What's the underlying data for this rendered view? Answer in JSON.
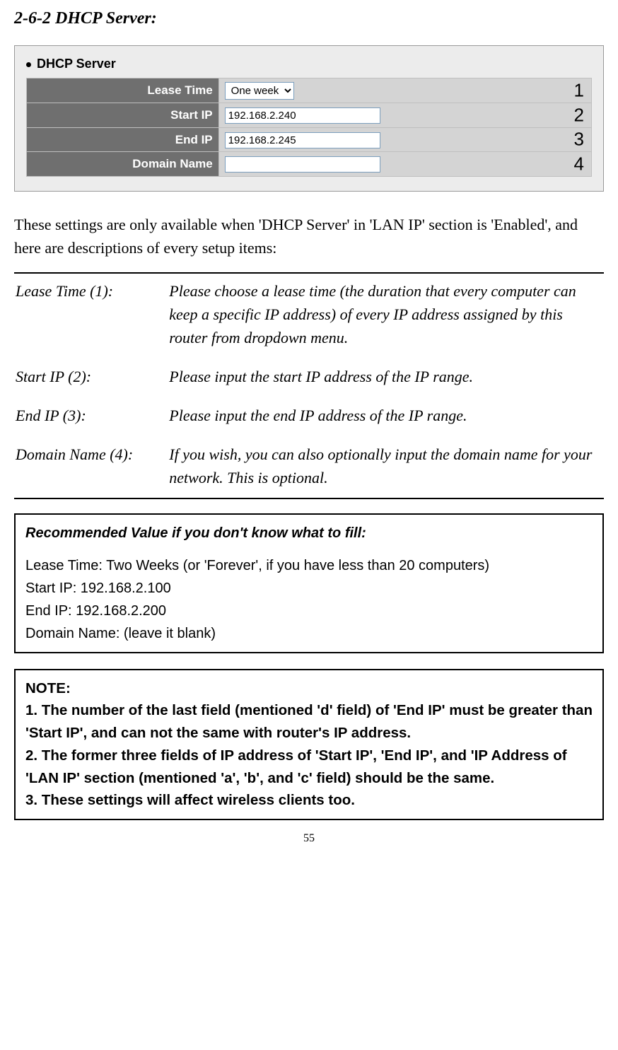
{
  "section_title": "2-6-2 DHCP Server:",
  "panel": {
    "title": "DHCP Server",
    "rows": [
      {
        "label": "Lease Time",
        "type": "select",
        "value": "One week",
        "num": "1"
      },
      {
        "label": "Start IP",
        "type": "text",
        "value": "192.168.2.240",
        "num": "2"
      },
      {
        "label": "End IP",
        "type": "text",
        "value": "192.168.2.245",
        "num": "3"
      },
      {
        "label": "Domain Name",
        "type": "text",
        "value": "",
        "num": "4"
      }
    ]
  },
  "intro": "These settings are only available when 'DHCP Server' in 'LAN IP' section is 'Enabled', and here are descriptions of every setup items:",
  "descriptions": [
    {
      "term": "Lease Time (1):",
      "desc": "Please choose a lease time (the duration that every computer can keep a specific IP address) of every IP address assigned by this router from dropdown menu."
    },
    {
      "term": "Start IP (2):",
      "desc": "Please input the start IP address of the IP range."
    },
    {
      "term": "End IP (3):",
      "desc": "Please input the end IP address of the IP range."
    },
    {
      "term": "Domain Name (4):",
      "desc": "If you wish, you can also optionally input the domain name for your network. This is optional."
    }
  ],
  "recommend": {
    "title": "Recommended Value if you don't know what to fill:",
    "lines": [
      "Lease Time: Two Weeks (or 'Forever', if you have less than 20 computers)",
      "Start IP: 192.168.2.100",
      "End IP: 192.168.2.200",
      "Domain Name: (leave it blank)"
    ]
  },
  "note": {
    "title": "NOTE:",
    "items": [
      "1. The number of the last field (mentioned 'd' field) of 'End IP' must be greater than 'Start IP', and can not the same with router's IP address.",
      "2. The former three fields of IP address of 'Start IP', 'End IP', and 'IP Address of 'LAN IP' section (mentioned 'a', 'b', and 'c' field) should be the same.",
      "3. These settings will affect wireless clients too."
    ]
  },
  "page_number": "55"
}
